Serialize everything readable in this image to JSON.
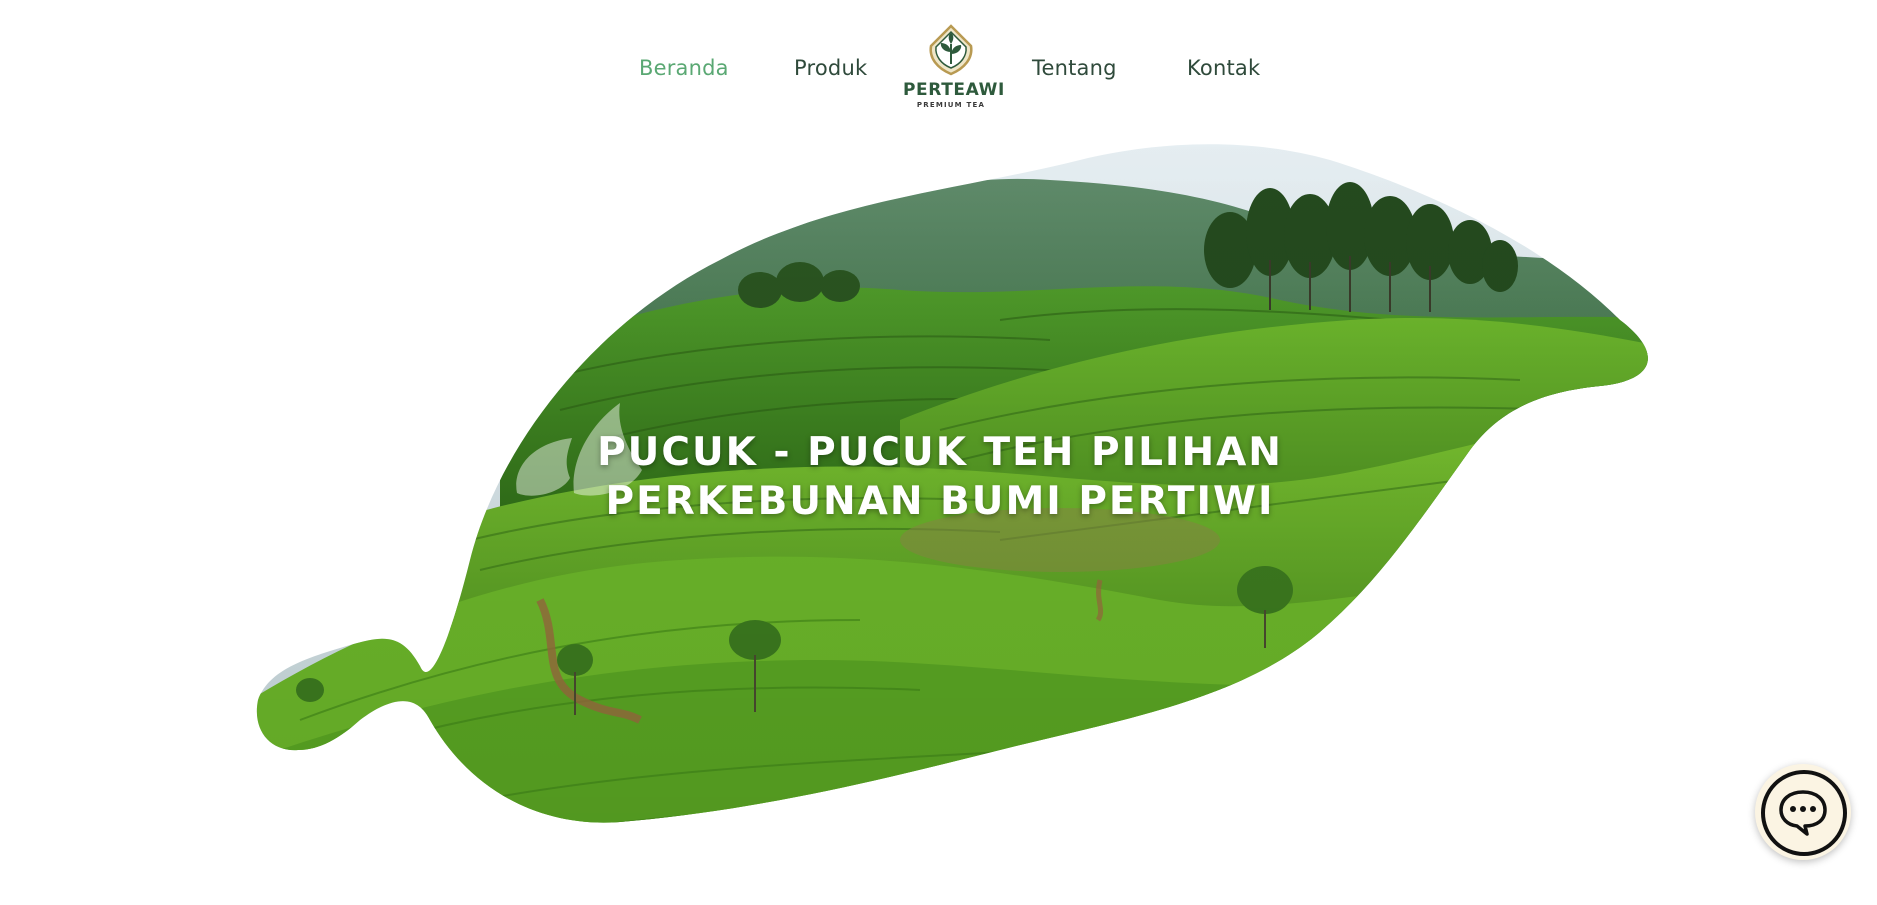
{
  "nav": {
    "items": [
      {
        "label": "Beranda",
        "active": true
      },
      {
        "label": "Produk",
        "active": false
      },
      {
        "label": "Tentang",
        "active": false
      },
      {
        "label": "Kontak",
        "active": false
      }
    ],
    "active_color": "#5aa873",
    "default_color": "#2f4a3b"
  },
  "logo": {
    "name": "PERTEAWI",
    "tagline": "PREMIUM TEA",
    "icon": "tea-leaf-emblem-icon"
  },
  "hero": {
    "title_line1": "PUCUK - PUCUK TEH PILIHAN",
    "title_line2": "PERKEBUNAN BUMI PERTIWI",
    "image": "tea-plantation-hills",
    "shape": "leaf"
  },
  "chat": {
    "icon": "chat-bubble-icon"
  },
  "colors": {
    "brand_green": "#2e5a3c",
    "accent_green": "#5aa873",
    "chat_bg": "#fbf4e3"
  }
}
